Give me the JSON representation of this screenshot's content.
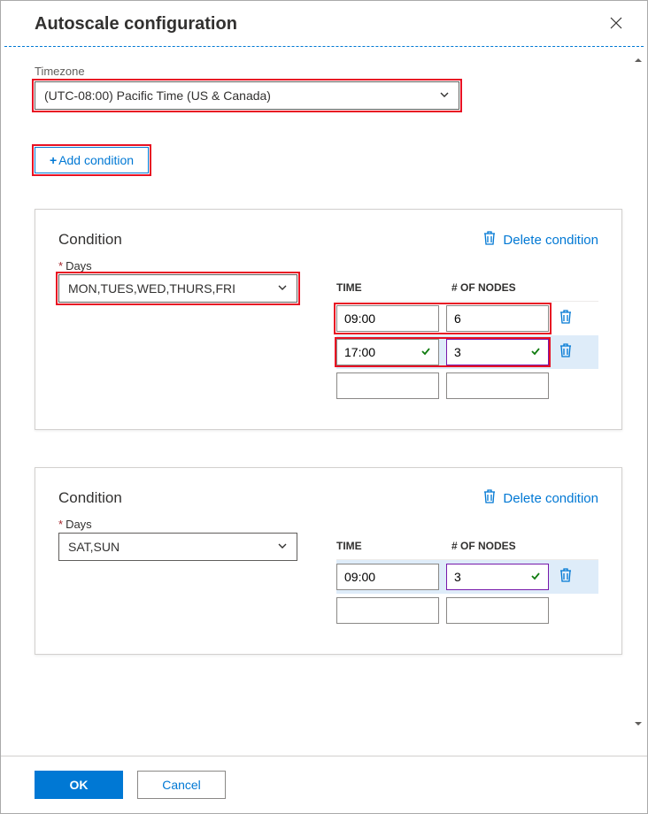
{
  "header": {
    "title": "Autoscale configuration"
  },
  "timezone": {
    "label": "Timezone",
    "value": "(UTC-08:00) Pacific Time (US & Canada)"
  },
  "add_condition_label": "Add condition",
  "delete_condition_label": "Delete condition",
  "condition_title": "Condition",
  "days_label": "Days",
  "table": {
    "col_time": "TIME",
    "col_nodes": "# OF NODES"
  },
  "conditions": [
    {
      "days": "MON,TUES,WED,THURS,FRI",
      "rows": [
        {
          "time": "09:00",
          "nodes": "6",
          "time_check": false,
          "nodes_check": false
        },
        {
          "time": "17:00",
          "nodes": "3",
          "time_check": true,
          "nodes_check": true
        }
      ]
    },
    {
      "days": "SAT,SUN",
      "rows": [
        {
          "time": "09:00",
          "nodes": "3",
          "time_check": false,
          "nodes_check": true
        }
      ]
    }
  ],
  "footer": {
    "ok": "OK",
    "cancel": "Cancel"
  }
}
